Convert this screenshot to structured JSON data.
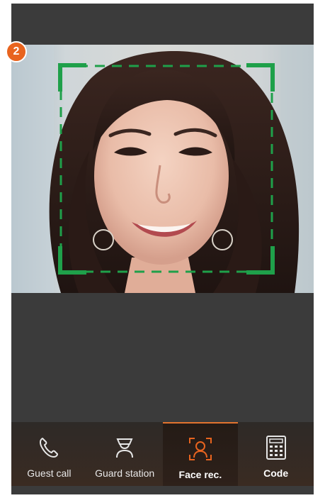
{
  "step_badge": "2",
  "colors": {
    "accent": "#e8641f",
    "face_frame": "#1fa04a",
    "nav_background": "#332822"
  },
  "camera": {
    "subject": "smiling woman with long dark hair",
    "frame_icon": "face-detection-frame"
  },
  "nav": {
    "items": [
      {
        "label": "Guest call",
        "icon": "phone-icon",
        "active": false
      },
      {
        "label": "Guard station",
        "icon": "guard-icon",
        "active": false
      },
      {
        "label": "Face rec.",
        "icon": "face-scan-icon",
        "active": true
      },
      {
        "label": "Code",
        "icon": "keypad-icon",
        "active": false
      }
    ]
  }
}
